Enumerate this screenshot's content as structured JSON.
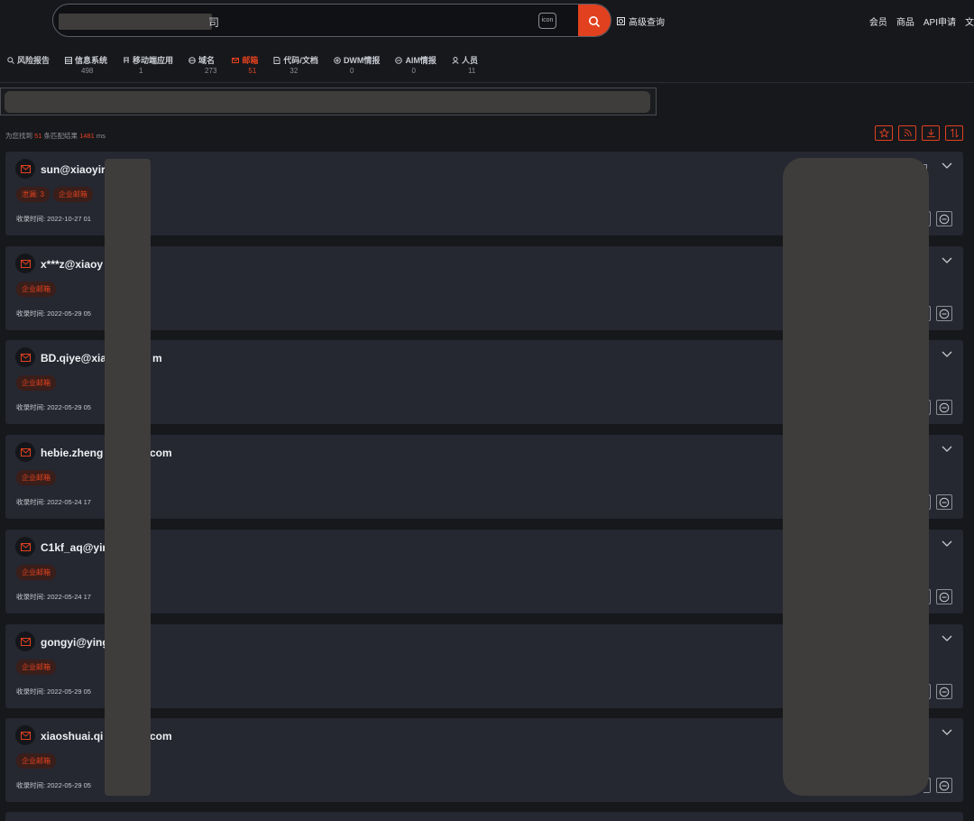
{
  "header": {
    "search_value_tail": "司",
    "icon_chip_label": "icon",
    "advanced_search": "高级查询",
    "links": [
      "会员",
      "商品",
      "API申请",
      "文"
    ]
  },
  "tabs": [
    {
      "label": "风险报告",
      "count": "",
      "icon": "search-icon"
    },
    {
      "label": "信息系统",
      "count": "498",
      "icon": "system-icon"
    },
    {
      "label": "移动端应用",
      "count": "1",
      "icon": "mobile-app-icon"
    },
    {
      "label": "域名",
      "count": "273",
      "icon": "domain-icon"
    },
    {
      "label": "邮箱",
      "count": "51",
      "icon": "mail-icon",
      "active": true
    },
    {
      "label": "代码/文档",
      "count": "32",
      "icon": "document-icon"
    },
    {
      "label": "DWM情报",
      "count": "0",
      "icon": "dwm-icon"
    },
    {
      "label": "AIM情报",
      "count": "0",
      "icon": "aim-icon"
    },
    {
      "label": "人员",
      "count": "11",
      "icon": "person-icon"
    }
  ],
  "summary": {
    "prefix": "为您找到",
    "count": "51",
    "middle": "条匹配结果",
    "ms": "1481",
    "suffix": "ms"
  },
  "results": [
    {
      "email": "sun@xiaoyir",
      "tags": [
        "泄漏: 3",
        "企业邮箱"
      ],
      "time": "收录时间: 2022-10-27 01"
    },
    {
      "email": "x***z@xiaoy",
      "tags": [
        "企业邮箱"
      ],
      "time": "收录时间: 2022-05-29 05"
    },
    {
      "email": "BD.qiye@xia",
      "email_tail": "m",
      "tags": [
        "企业邮箱"
      ],
      "time": "收录时间: 2022-05-29 05"
    },
    {
      "email": "hebie.zheng",
      "email_tail": "com",
      "tags": [
        "企业邮箱"
      ],
      "time": "收录时间: 2022-05-24 17"
    },
    {
      "email": "C1kf_aq@yir",
      "tags": [
        "企业邮箱"
      ],
      "time": "收录时间: 2022-05-24 17"
    },
    {
      "email": "gongyi@ying",
      "tags": [
        "企业邮箱"
      ],
      "time": "收录时间: 2022-05-29 05"
    },
    {
      "email": "xiaoshuai.qi",
      "email_tail": "com",
      "tags": [
        "企业邮箱"
      ],
      "time": "收录时间: 2022-05-29 05"
    }
  ],
  "colors": {
    "accent": "#e2411f",
    "background": "#17181c",
    "card": "#252731"
  }
}
